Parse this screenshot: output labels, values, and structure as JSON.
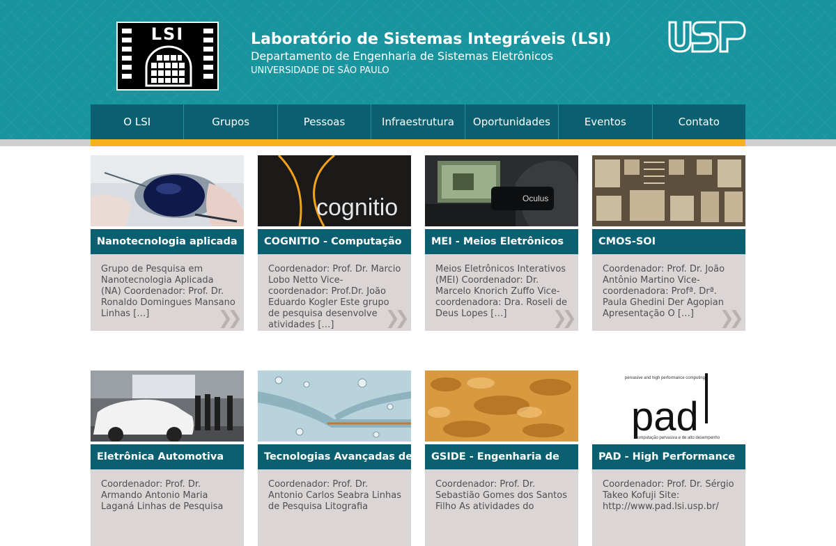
{
  "header": {
    "logo_text": "LSI",
    "title": "Laboratório de Sistemas Integráveis (LSI)",
    "department": "Departamento de Engenharia de Sistemas Eletrônicos",
    "university": "UNIVERSIDADE DE SÃO PAULO",
    "usp_logo_text": "USP"
  },
  "nav": {
    "items": [
      "O LSI",
      "Grupos",
      "Pessoas",
      "Infraestrutura",
      "Oportunidades",
      "Eventos",
      "Contato"
    ]
  },
  "colors": {
    "header_bg": "#17949d",
    "nav_bg": "#0a6070",
    "accent": "#f6b21c",
    "card_body_bg": "#dbd6d5"
  },
  "cards": [
    {
      "title": "Nanotecnologia aplicada",
      "excerpt": "Grupo de Pesquisa em Nanotecnologia Aplicada (NA) Coordenador: Prof. Dr. Ronaldo Domingues Mansano Linhas […]"
    },
    {
      "title": "COGNITIO - Computação",
      "excerpt": "Coordenador: Prof. Dr. Marcio Lobo Netto Vice-coordenador: Prof.Dr. João Eduardo Kogler Este grupo de pesquisa desenvolve atividades […]",
      "image_text": "cognitio"
    },
    {
      "title": "MEI - Meios Eletrônicos",
      "excerpt": "Meios Eletrônicos Interativos (MEI) Coordenador: Dr. Marcelo Knorich Zuffo Vice-coordenadora: Dra. Roseli de Deus Lopes […]",
      "image_text": "Oculus"
    },
    {
      "title": "CMOS-SOI",
      "excerpt": "Coordenador: Prof. Dr. João Antônio Martino Vice-coordenadora: Profª. Drª. Paula Ghedini Der Agopian Apresentação O […]"
    },
    {
      "title": "Eletrônica Automotiva",
      "excerpt": "Coordenador: Prof. Dr. Armando Antonio Maria Laganá     Linhas de Pesquisa"
    },
    {
      "title": "Tecnologias Avançadas de",
      "excerpt": "Coordenador: Prof. Dr. Antonio Carlos Seabra Linhas de Pesquisa Litografia"
    },
    {
      "title": "GSIDE - Engenharia de",
      "excerpt": "Coordenador: Prof. Dr. Sebastião Gomes dos Santos Filho As atividades do"
    },
    {
      "title": "PAD - High Performance",
      "excerpt": "Coordenador: Prof. Dr. Sérgio Takeo Kofuji Site: http://www.pad.lsi.usp.br/",
      "image_text": "pad",
      "image_caption_top": "pervasive and high performance computing",
      "image_caption_bottom": "computação pervasiva e de alto desempenho"
    }
  ]
}
